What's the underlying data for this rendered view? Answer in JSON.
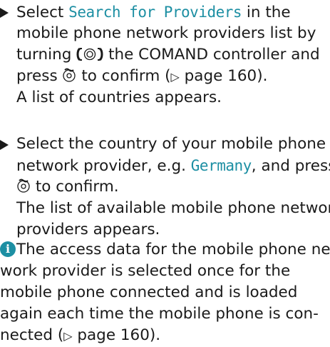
{
  "step1": {
    "line1_pre": "Select ",
    "line1_hl": "Search for Providers",
    "line1_post": " in the",
    "line2": "mobile phone network providers list by",
    "line3_pre": "turning ",
    "line3_post": " the COMAND controller and",
    "line4_pre": "press ",
    "line4_post": " to confirm (",
    "page_ref_glyph": "▷",
    "line4_end": " page 160).",
    "result": "A list of countries appears."
  },
  "step2": {
    "line1": "Select the country of your mobile phone",
    "line2_pre": "network provider, e.g. ",
    "line2_hl": "Germany",
    "line2_post": ", and press",
    "line3_post": " to confirm.",
    "result1": "The list of available mobile phone network",
    "result2": "providers appears."
  },
  "note": {
    "icon_letter": "i",
    "line1": "The access data for the mobile phone net-",
    "line2": "work provider is selected once for the",
    "line3": "mobile phone connected and is loaded",
    "line4": "again each time the mobile phone is con-",
    "line5_pre": "nected (",
    "page_ref_glyph": "▷",
    "line5_end": " page 160)."
  },
  "colors": {
    "highlight": "#1d8fa3",
    "text": "#1a1a1a"
  },
  "icons": {
    "turn": "controller-turn-icon",
    "press": "controller-press-icon",
    "info": "info-icon",
    "bullet": "step-bullet-icon"
  }
}
